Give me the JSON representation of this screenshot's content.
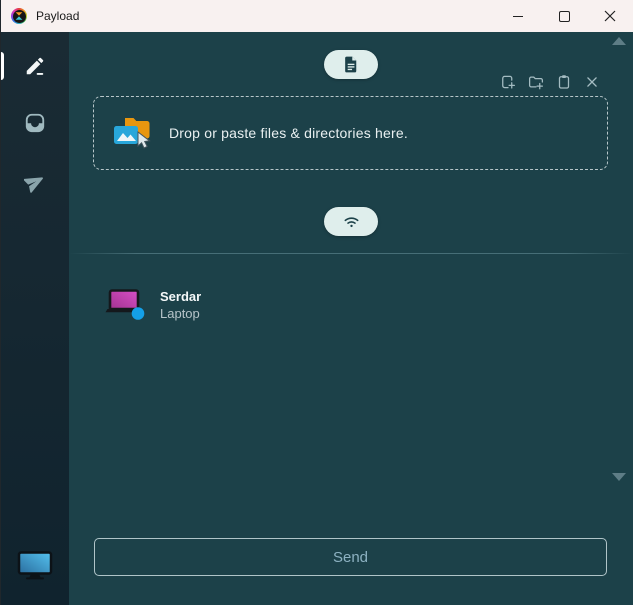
{
  "window": {
    "title": "Payload"
  },
  "titlebar": {
    "controls": [
      "minimize",
      "maximize",
      "close"
    ]
  },
  "sidebar": {
    "items": [
      {
        "id": "compose",
        "icon": "pencil-icon",
        "active": true
      },
      {
        "id": "devices",
        "icon": "inbox-device-icon",
        "active": false
      },
      {
        "id": "transfers",
        "icon": "paper-plane-icon",
        "active": false
      }
    ],
    "self_device_icon": "monitor-icon"
  },
  "toolbar": {
    "icons": [
      "add-file-icon",
      "add-folder-icon",
      "clipboard-paste-icon",
      "close-icon"
    ]
  },
  "pills": {
    "files_icon": "document-icon",
    "network_icon": "wifi-icon"
  },
  "dropzone": {
    "label": "Drop or paste files & directories here.",
    "icon": "folder-image-cursor-icon"
  },
  "devices": [
    {
      "name": "Serdar",
      "type": "Laptop",
      "online": true,
      "avatar": "laptop-icon"
    }
  ],
  "footer": {
    "send_label": "Send"
  },
  "colors": {
    "titlebar_bg": "#f8f1f0",
    "sidebar_bg": "#14242f",
    "main_bg": "#1c4149",
    "pill_bg": "#dfeeec",
    "dropzone_border": "#b7c6c9",
    "folder_orange": "#e8960f",
    "image_blue": "#28a7db",
    "laptop_magenta": "#c243b2",
    "online_dot_blue": "#14a0e8",
    "send_text": "#8db2c2"
  }
}
